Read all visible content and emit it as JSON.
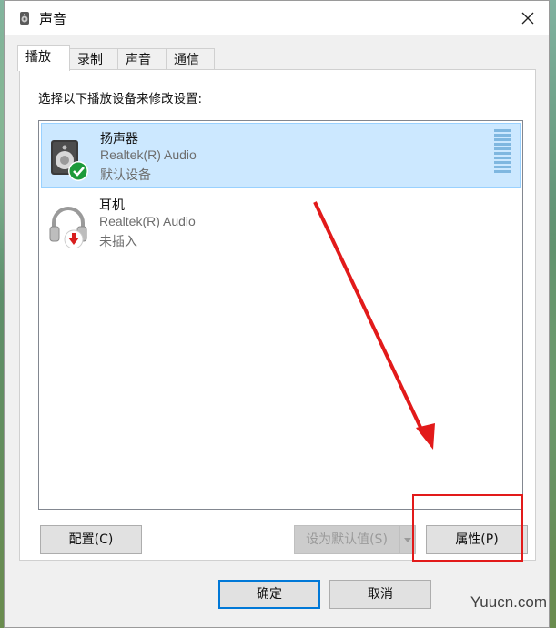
{
  "window": {
    "title": "声音",
    "close_icon": "close-icon"
  },
  "tabs": [
    {
      "label": "播放",
      "active": true
    },
    {
      "label": "录制",
      "active": false
    },
    {
      "label": "声音",
      "active": false
    },
    {
      "label": "通信",
      "active": false
    }
  ],
  "panel": {
    "instruction": "选择以下播放设备来修改设置:"
  },
  "devices": [
    {
      "name": "扬声器",
      "driver": "Realtek(R) Audio",
      "status": "默认设备",
      "selected": true,
      "icon": "speaker-icon",
      "badge": "check-badge-icon"
    },
    {
      "name": "耳机",
      "driver": "Realtek(R) Audio",
      "status": "未插入",
      "selected": false,
      "icon": "headphones-icon",
      "badge": "unplugged-badge-icon"
    }
  ],
  "buttons": {
    "configure": "配置(C)",
    "set_default": "设为默认值(S)",
    "properties": "属性(P)",
    "ok": "确定",
    "cancel": "取消"
  },
  "watermark": "Yuucn.com",
  "colors": {
    "selection": "#cce8ff",
    "annotation": "#e21a1a",
    "accent": "#0078d7"
  }
}
